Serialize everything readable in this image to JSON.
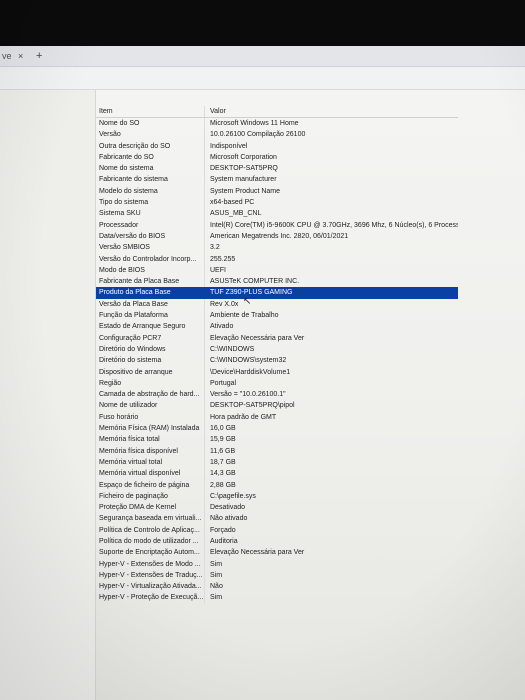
{
  "browser": {
    "tab_fragment": "ve",
    "close_glyph": "×",
    "new_tab_glyph": "+"
  },
  "table": {
    "headers": {
      "item": "Item",
      "value": "Valor"
    },
    "selected_row": 17,
    "rows": [
      {
        "item": "Nome do SO",
        "value": "Microsoft Windows 11 Home"
      },
      {
        "item": "Versão",
        "value": "10.0.26100 Compilação 26100"
      },
      {
        "item": "Outra descrição do SO",
        "value": "Indisponível"
      },
      {
        "item": "Fabricante do SO",
        "value": "Microsoft Corporation"
      },
      {
        "item": "Nome do sistema",
        "value": "DESKTOP-SAT5PRQ"
      },
      {
        "item": "Fabricante do sistema",
        "value": "System manufacturer"
      },
      {
        "item": "Modelo do sistema",
        "value": "System Product Name"
      },
      {
        "item": "Tipo do sistema",
        "value": "x64-based PC"
      },
      {
        "item": "Sistema SKU",
        "value": "ASUS_MB_CNL"
      },
      {
        "item": "Processador",
        "value": "Intel(R) Core(TM) i5-9600K CPU @ 3.70GHz, 3696 Mhz, 6 Núcleo(s), 6 Process..."
      },
      {
        "item": "Data/versão do BIOS",
        "value": "American Megatrends Inc. 2820, 06/01/2021"
      },
      {
        "item": "Versão SMBIOS",
        "value": "3.2"
      },
      {
        "item": "Versão do Controlador Incorp...",
        "value": "255.255"
      },
      {
        "item": "Modo de BIOS",
        "value": "UEFI"
      },
      {
        "item": "Fabricante da Placa Base",
        "value": "ASUSTeK COMPUTER INC."
      },
      {
        "item": "Produto da Placa Base",
        "value": "TUF Z390-PLUS GAMING"
      },
      {
        "item": "Versão da Placa Base",
        "value": "Rev X.0x"
      },
      {
        "item": "Função da Plataforma",
        "value": "Ambiente de Trabalho"
      },
      {
        "item": "Estado de Arranque Seguro",
        "value": "Ativado"
      },
      {
        "item": "Configuração PCR7",
        "value": "Elevação Necessária para Ver"
      },
      {
        "item": "Diretório do Windows",
        "value": "C:\\WINDOWS"
      },
      {
        "item": "Diretório do sistema",
        "value": "C:\\WINDOWS\\system32"
      },
      {
        "item": "Dispositivo de arranque",
        "value": "\\Device\\HarddiskVolume1"
      },
      {
        "item": "Região",
        "value": "Portugal"
      },
      {
        "item": "Camada de abstração de hard...",
        "value": "Versão = \"10.0.26100.1\""
      },
      {
        "item": "Nome de utilizador",
        "value": "DESKTOP-SAT5PRQ\\pipol"
      },
      {
        "item": "Fuso horário",
        "value": "Hora padrão de GMT"
      },
      {
        "item": "Memória Física (RAM) Instalada",
        "value": "16,0 GB"
      },
      {
        "item": "Memória física total",
        "value": "15,9 GB"
      },
      {
        "item": "Memória física disponível",
        "value": "11,6 GB"
      },
      {
        "item": "Memória virtual total",
        "value": "18,7 GB"
      },
      {
        "item": "Memória virtual disponível",
        "value": "14,3 GB"
      },
      {
        "item": "Espaço de ficheiro de página",
        "value": "2,88 GB"
      },
      {
        "item": "Ficheiro de paginação",
        "value": "C:\\pagefile.sys"
      },
      {
        "item": "Proteção DMA de Kernel",
        "value": "Desativado"
      },
      {
        "item": "Segurança baseada em virtuali...",
        "value": "Não ativado"
      },
      {
        "item": "Política de Controlo de Aplicaç...",
        "value": "Forçado"
      },
      {
        "item": "Política do modo de utilizador ...",
        "value": "Auditoria"
      },
      {
        "item": "Suporte de Encriptação Autom...",
        "value": "Elevação Necessária para Ver"
      },
      {
        "item": "Hyper-V - Extensões de Modo ...",
        "value": "Sim"
      },
      {
        "item": "Hyper-V - Extensões de Traduç...",
        "value": "Sim"
      },
      {
        "item": "Hyper-V - Virtualização Ativada...",
        "value": "Não"
      },
      {
        "item": "Hyper-V - Proteção de Execuçã...",
        "value": "Sim"
      }
    ]
  }
}
